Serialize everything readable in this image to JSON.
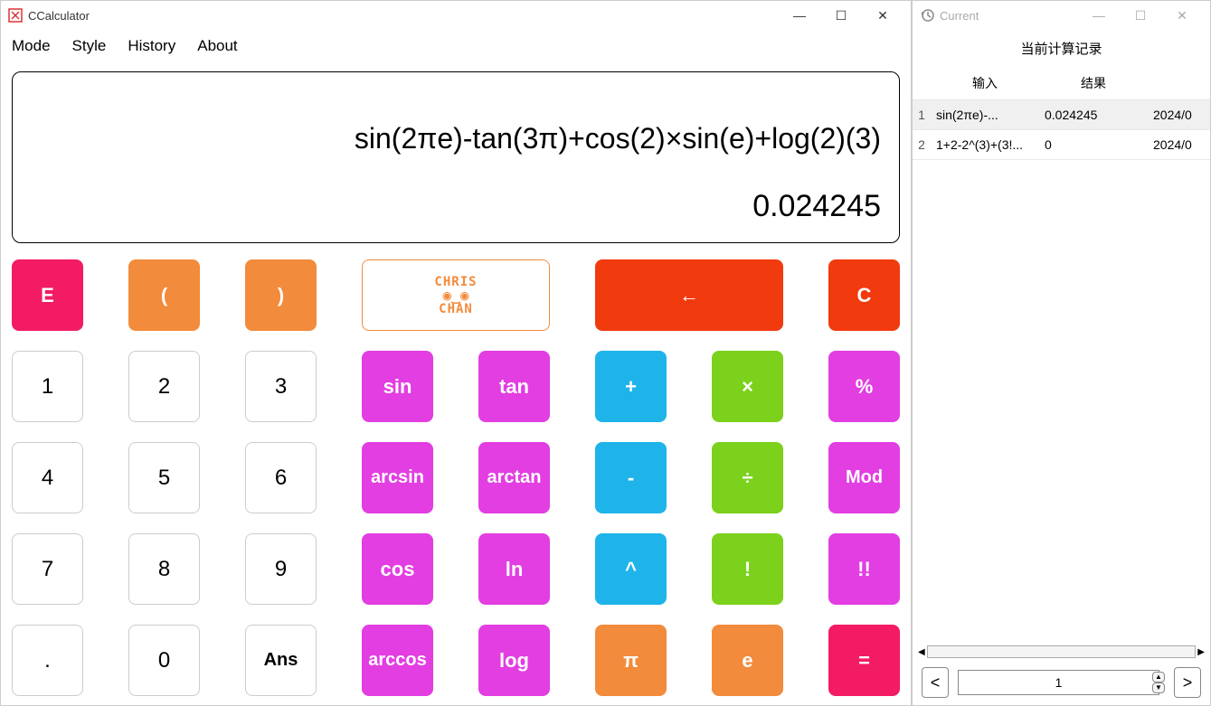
{
  "main_window": {
    "title": "CCalculator",
    "menu": {
      "mode": "Mode",
      "style": "Style",
      "history": "History",
      "about": "About"
    },
    "display": {
      "expression": "sin(2πe)-tan(3π)+cos(2)×sin(e)+log(2)(3)",
      "result": "0.024245"
    },
    "buttons": {
      "E": "E",
      "lparen": "(",
      "rparen": ")",
      "logo_top": "CHRIS",
      "logo_bottom": "CHAN",
      "back": "←",
      "C": "C",
      "1": "1",
      "2": "2",
      "3": "3",
      "sin": "sin",
      "tan": "tan",
      "plus": "+",
      "times": "×",
      "pct": "%",
      "4": "4",
      "5": "5",
      "6": "6",
      "arcsin": "arcsin",
      "arctan": "arctan",
      "minus": "-",
      "div": "÷",
      "mod": "Mod",
      "7": "7",
      "8": "8",
      "9": "9",
      "cos": "cos",
      "ln": "ln",
      "pow": "^",
      "fact": "!",
      "dfact": "!!",
      "dot": ".",
      "0": "0",
      "ans": "Ans",
      "arccos": "arccos",
      "log": "log",
      "pi": "π",
      "e": "e",
      "eq": "="
    }
  },
  "history_window": {
    "title": "Current",
    "heading": "当前计算记录",
    "columns": {
      "input": "输入",
      "result": "结果"
    },
    "rows": [
      {
        "n": "1",
        "input": "sin(2πe)-...",
        "result": "0.024245",
        "date": "2024/0"
      },
      {
        "n": "2",
        "input": "1+2-2^(3)+(3!...",
        "result": "0",
        "date": "2024/0"
      }
    ],
    "page": "1"
  }
}
